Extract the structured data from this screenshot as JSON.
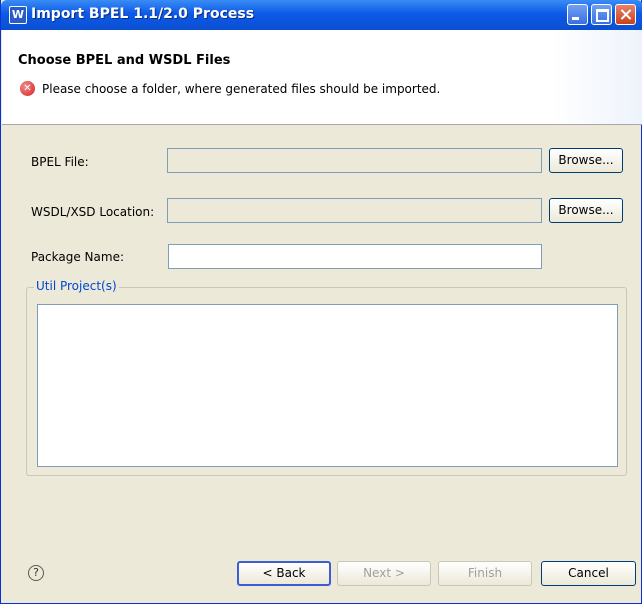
{
  "window": {
    "title": "Import BPEL 1.1/2.0 Process",
    "app_icon_glyph": "W"
  },
  "header": {
    "title": "Choose BPEL and WSDL Files",
    "error_icon": "error-icon",
    "error_message": "Please choose a folder, where generated files should be imported."
  },
  "form": {
    "bpel_label": "BPEL File:",
    "bpel_value": "",
    "wsdl_label": "WSDL/XSD Location:",
    "wsdl_value": "",
    "package_label": "Package Name:",
    "package_value": "",
    "browse_label": "Browse..."
  },
  "util_group": {
    "legend": "Util Project(s)",
    "items": []
  },
  "footer": {
    "help_glyph": "?",
    "back_label": "< Back",
    "next_label": "Next >",
    "finish_label": "Finish",
    "cancel_label": "Cancel"
  },
  "colors": {
    "title_bar": "#0a4fd2",
    "dialog_bg": "#ece9d8",
    "error_red": "#d32020",
    "legend_blue": "#0046d5"
  }
}
